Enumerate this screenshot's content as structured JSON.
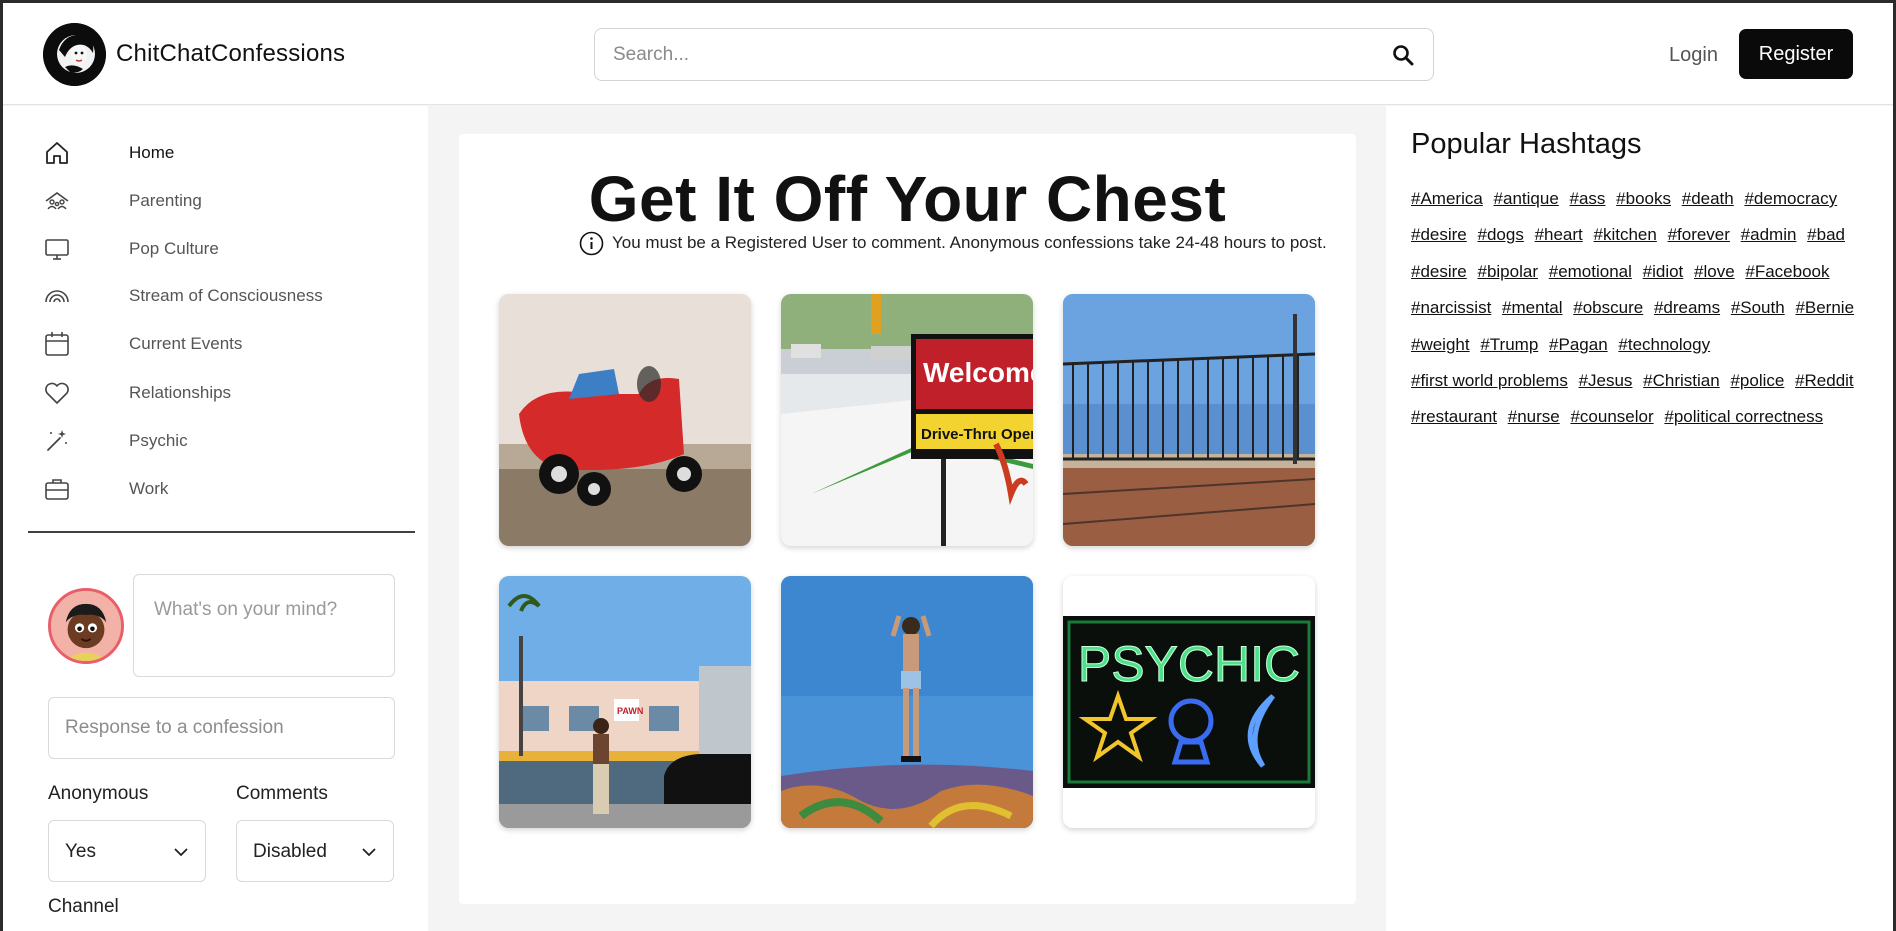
{
  "header": {
    "brand": "ChitChatConfessions",
    "search_placeholder": "Search...",
    "login_label": "Login",
    "register_label": "Register"
  },
  "sidebar": {
    "items": [
      {
        "label": "Home",
        "icon": "home-icon"
      },
      {
        "label": "Parenting",
        "icon": "family-icon"
      },
      {
        "label": "Pop Culture",
        "icon": "monitor-icon"
      },
      {
        "label": "Stream of Consciousness",
        "icon": "rainbow-icon"
      },
      {
        "label": "Current Events",
        "icon": "calendar-icon"
      },
      {
        "label": "Relationships",
        "icon": "heart-icon"
      },
      {
        "label": "Psychic",
        "icon": "magic-wand-icon"
      },
      {
        "label": "Work",
        "icon": "briefcase-icon"
      }
    ]
  },
  "composer": {
    "mind_placeholder": "What's on your mind?",
    "response_placeholder": "Response to a confession",
    "anonymous_label": "Anonymous",
    "anonymous_value": "Yes",
    "comments_label": "Comments",
    "comments_value": "Disabled",
    "channel_label": "Channel"
  },
  "main": {
    "title": "Get It Off Your Chest",
    "notice": "You must be a Registered User to comment. Anonymous confessions take 24-48 hours to post.",
    "images": [
      {
        "subject": "red toy car"
      },
      {
        "subject": "welcome drive-thru sign",
        "sign_text": "Welcome",
        "sign_sub": "Drive-Thru Open"
      },
      {
        "subject": "metal fence"
      },
      {
        "subject": "man walking by building",
        "sign_text": "PAWN"
      },
      {
        "subject": "woman standing on graffiti wall"
      },
      {
        "subject": "neon psychic sign",
        "sign_text": "PSYCHIC"
      }
    ]
  },
  "hashtags": {
    "title": "Popular Hashtags",
    "tags": [
      "#America",
      "#antique",
      "#ass",
      "#books",
      "#death",
      "#democracy",
      "#desire",
      "#dogs",
      "#heart",
      "#kitchen",
      "#forever",
      "#admin",
      "#bad",
      "#desire",
      "#bipolar",
      "#emotional",
      "#idiot",
      "#love",
      "#Facebook",
      "#narcissist",
      "#mental",
      "#obscure",
      "#dreams",
      "#South",
      "#Bernie",
      "#weight",
      "#Trump",
      "#Pagan",
      "#technology",
      "#first world problems",
      "#Jesus",
      "#Christian",
      "#police",
      "#Reddit",
      "#restaurant",
      "#nurse",
      "#counselor",
      "#political correctness"
    ]
  },
  "colors": {
    "accent": "#0a0a0a",
    "background": "#f4f4f5",
    "avatar_border": "#e85f6a"
  }
}
